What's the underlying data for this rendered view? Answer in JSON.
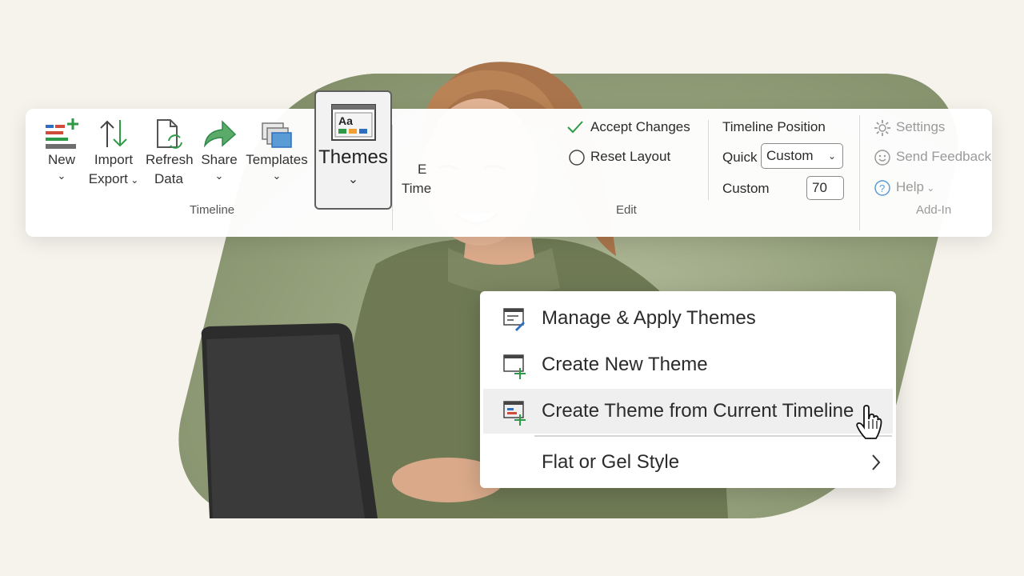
{
  "ribbon": {
    "timeline_group": {
      "label": "Timeline",
      "new": "New",
      "import": "Import",
      "export": "Export",
      "refresh": "Refresh",
      "data": "Data",
      "share": "Share",
      "templates": "Templates"
    },
    "themes": {
      "label": "Themes",
      "icon_text": "Aa"
    },
    "edit_timeline": {
      "line1": "E",
      "line2": "Time"
    },
    "edit_group": {
      "label": "Edit",
      "accept": "Accept Changes",
      "reset": "Reset Layout"
    },
    "position_group": {
      "title": "Timeline Position",
      "quick_label": "Quick",
      "quick_value": "Custom",
      "custom_label": "Custom",
      "custom_value": "70"
    },
    "addin_group": {
      "label": "Add-In",
      "settings": "Settings",
      "feedback": "Send Feedback",
      "help": "Help"
    }
  },
  "menu": {
    "items": [
      {
        "label": "Manage & Apply Themes",
        "icon": "manage-themes-icon"
      },
      {
        "label": "Create New Theme",
        "icon": "create-theme-icon"
      },
      {
        "label": "Create Theme from Current Timeline",
        "icon": "create-theme-from-timeline-icon",
        "hovered": true
      },
      {
        "label": "Flat or Gel Style",
        "icon": "submenu-chevron-icon"
      }
    ]
  },
  "colors": {
    "accent_green": "#2e9a48",
    "accent_blue": "#2f6fbf",
    "accent_red": "#d04b3a",
    "accent_orange": "#f0a030",
    "bg": "#f6f2ec",
    "blob": "#9aa682"
  }
}
